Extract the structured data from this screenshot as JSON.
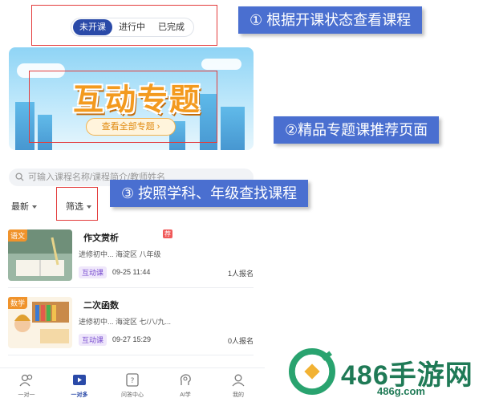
{
  "status_tabs": [
    "未开课",
    "进行中",
    "已完成"
  ],
  "status_active": 0,
  "banner": {
    "title": "互动专题",
    "button": "查看全部专题 ›"
  },
  "search": {
    "placeholder": "可输入课程名称/课程简介/教师姓名"
  },
  "filters": {
    "sort": "最新",
    "filter": "筛选"
  },
  "courses": [
    {
      "subject": "语文",
      "title": "作文赏析",
      "badge": "荐",
      "meta": "进修初中...  海淀区   八年级",
      "tag": "互动课",
      "time": "09-25 11:44",
      "count": "1人报名"
    },
    {
      "subject": "数学",
      "title": "二次函数",
      "badge": "",
      "meta": "进修初中...  海淀区   七/八/九...",
      "tag": "互动课",
      "time": "09-27 15:29",
      "count": "0人报名"
    }
  ],
  "tabbar": [
    {
      "label": "一对一",
      "icon": "people-icon"
    },
    {
      "label": "一对多",
      "icon": "video-play-icon"
    },
    {
      "label": "问答中心",
      "icon": "qa-icon"
    },
    {
      "label": "AI学",
      "icon": "ai-brain-icon"
    },
    {
      "label": "我的",
      "icon": "user-icon"
    }
  ],
  "tabbar_active": 1,
  "callouts": [
    "① 根据开课状态查看课程",
    "②精品专题课推荐页面",
    "③ 按照学科、年级查找课程"
  ],
  "watermark": {
    "title": "486手游网",
    "url": "486g.com"
  },
  "colors": {
    "primary": "#2a4aa8",
    "callout": "#4a6fd0",
    "highlight": "#e33c3c",
    "banner_text": "#f39a1f"
  }
}
